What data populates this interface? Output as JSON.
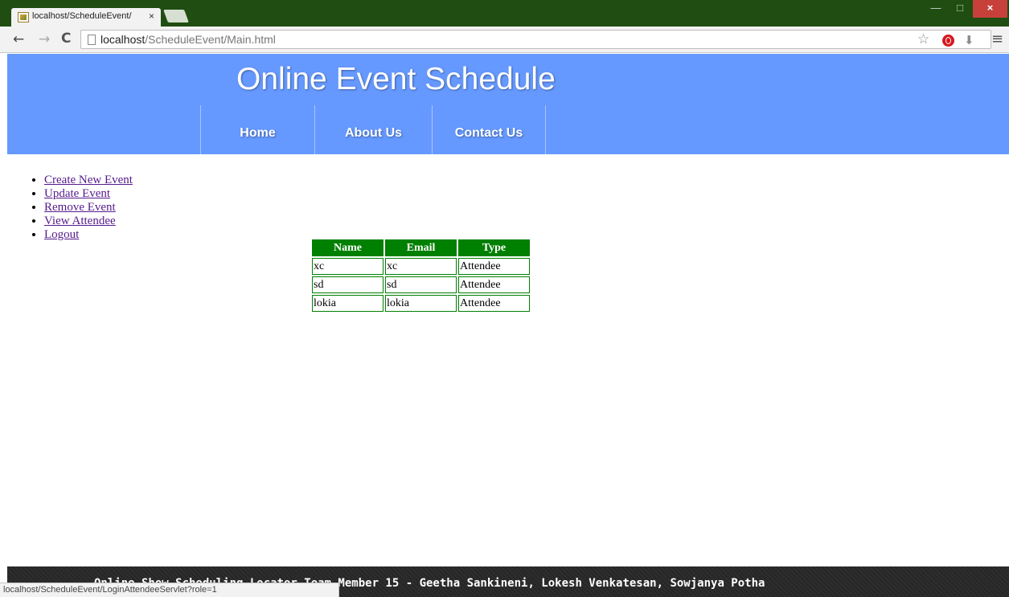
{
  "browser": {
    "tab_title": "localhost/ScheduleEvent/",
    "tab_close": "×",
    "url_host": "localhost",
    "url_path": "/ScheduleEvent/Main.html",
    "status_url": "localhost/ScheduleEvent/LoginAttendeeServlet?role=1",
    "icons": {
      "back": "←",
      "forward": "→",
      "reload": "C",
      "star": "☆",
      "download": "⬇",
      "menu": "≡",
      "minimize": "—",
      "maximize": "□",
      "close": "×"
    }
  },
  "header": {
    "title": "Online Event Schedule",
    "nav": [
      {
        "label": "Home"
      },
      {
        "label": "About Us"
      },
      {
        "label": "Contact Us"
      }
    ]
  },
  "side_menu": [
    {
      "label": "Create New Event"
    },
    {
      "label": "Update Event"
    },
    {
      "label": "Remove Event"
    },
    {
      "label": "View Attendee"
    },
    {
      "label": "Logout"
    }
  ],
  "table": {
    "columns": [
      "Name",
      "Email",
      "Type"
    ],
    "rows": [
      [
        "xc",
        "xc",
        "Attendee"
      ],
      [
        "sd",
        "sd",
        "Attendee"
      ],
      [
        "lokia",
        "lokia",
        "Attendee"
      ]
    ]
  },
  "footer": {
    "text": "Online Show Scheduling Locator Team Member 15 - Geetha Sankineni, Lokesh Venkatesan, Sowjanya Potha"
  },
  "colors": {
    "header_bg": "#6699ff",
    "table_header_bg": "#008000",
    "link": "#551a8b",
    "titlebar": "#1f4d12"
  }
}
